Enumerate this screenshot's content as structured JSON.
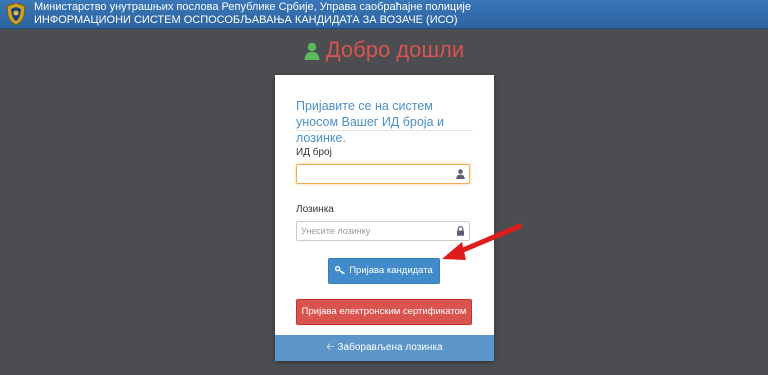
{
  "header": {
    "line1": "Министарство унутрашњих послова Републике Србије, Управа саобраћајне полиције",
    "line2": "ИНФОРМАЦИОНИ СИСТЕМ ОСПОСОБЉАВАЊА КАНДИДАТА ЗА ВОЗАЧЕ (ИСО)",
    "logo_icon": "police-crest-icon"
  },
  "page": {
    "title": "Добро дошли",
    "title_icon": "user-icon",
    "title_color": "#d9534f"
  },
  "login_form": {
    "intro": "Пријавите се на систем уносом Вашег ИД броја и лозинке.",
    "id_label": "ИД број",
    "id_value": "",
    "id_icon": "user-icon",
    "password_label": "Лозинка",
    "password_placeholder": "Унесите лозинку",
    "password_icon": "lock-icon",
    "login_button": "Пријава кандидата",
    "login_button_icon": "key-icon",
    "cert_button": "Пријава електронским сертификатом",
    "forgot_password": "Заборављена лозинка",
    "forgot_icon": "arrow-left-icon"
  },
  "annotation": {
    "arrow_color": "#e01b1b"
  },
  "colors": {
    "header_bg": "#3a77b8",
    "page_bg": "#4b4d51",
    "primary": "#428bca",
    "danger": "#d9534f",
    "footer_bg": "#5b95c9"
  }
}
